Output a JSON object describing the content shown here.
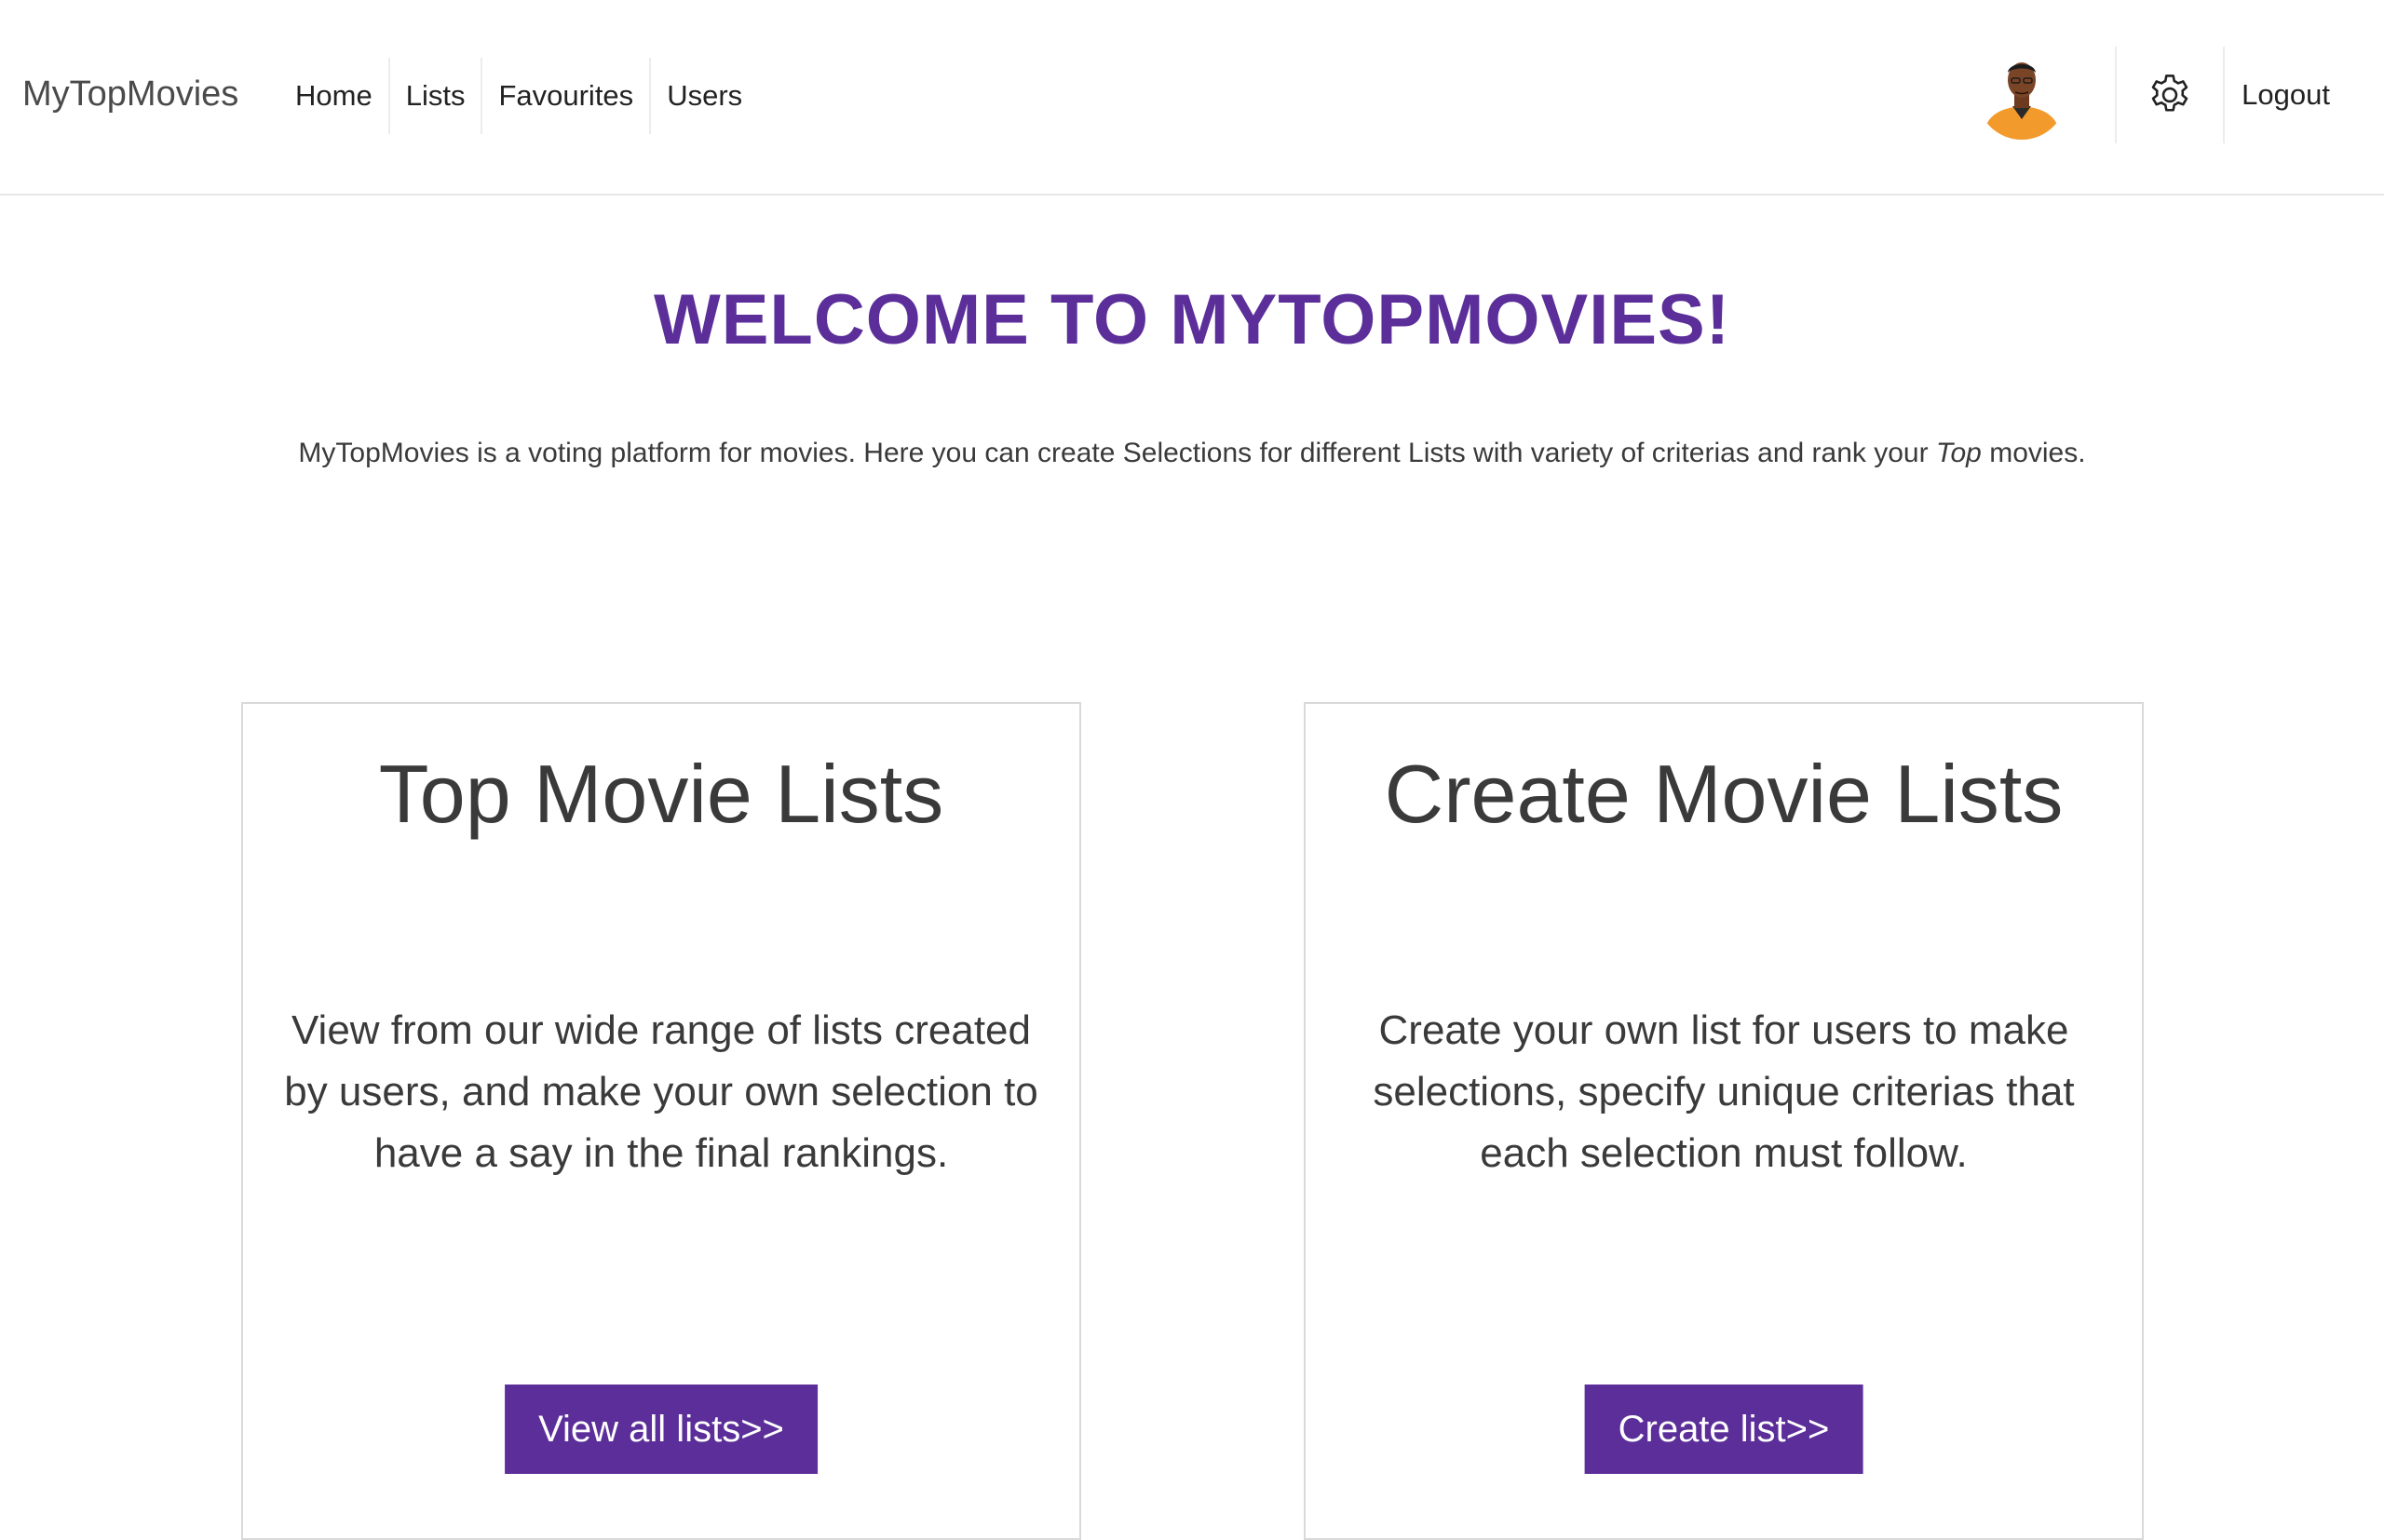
{
  "navbar": {
    "brand": "MyTopMovies",
    "links": [
      "Home",
      "Lists",
      "Favourites",
      "Users"
    ],
    "logout": "Logout"
  },
  "hero": {
    "title": "WELCOME TO MYTOPMOVIES!",
    "text_before": "MyTopMovies is a voting platform for movies. Here you can create Selections for different Lists with variety of criterias and rank your ",
    "text_em": "Top",
    "text_after": " movies."
  },
  "cards": [
    {
      "title": "Top Movie Lists",
      "text": "View from our wide range of lists created by users, and make your own selection to have a say in the final rankings.",
      "button": "View all lists>>"
    },
    {
      "title": "Create Movie Lists",
      "text": "Create your own list for users to make selections, specify unique criterias that each selection must follow.",
      "button": "Create list>>"
    }
  ],
  "colors": {
    "accent": "#5b2e99",
    "text": "#3a3a3a",
    "avatar_shirt": "#f39a2c"
  },
  "icons": [
    "avatar",
    "gear-icon"
  ]
}
